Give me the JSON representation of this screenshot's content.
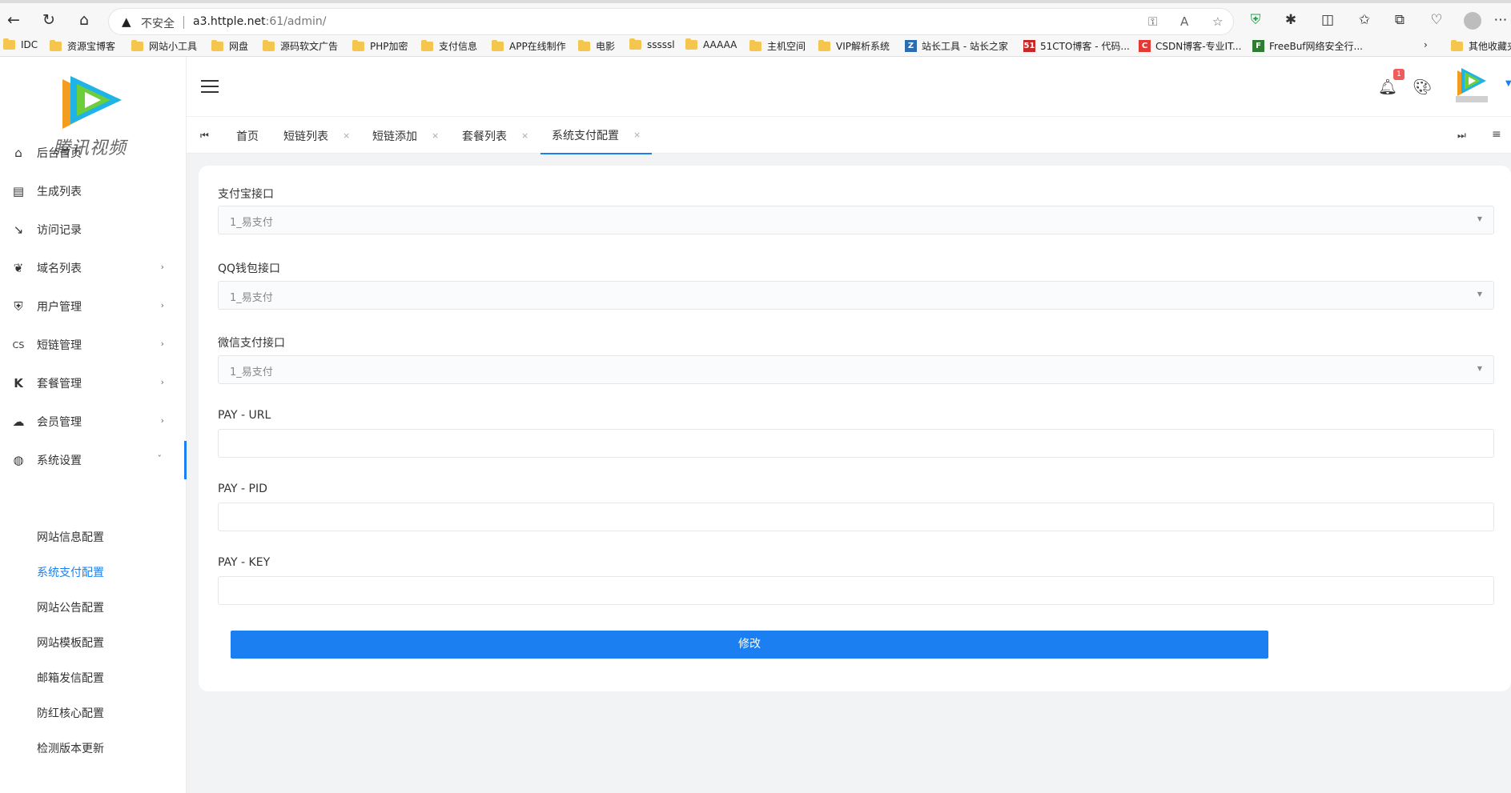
{
  "browser": {
    "insecure_label": "不安全",
    "url_host": "a3.httple.net",
    "url_rest": ":61/admin/",
    "bookmarks": [
      "IDC",
      "资源宝博客",
      "网站小工具",
      "网盘",
      "源码软文广告",
      "PHP加密",
      "支付信息",
      "APP在线制作",
      "电影",
      "sssssl",
      "AAAAA",
      "主机空间",
      "VIP解析系统",
      "站长工具 - 站长之家",
      "51CTO博客 - 代码...",
      "CSDN博客-专业IT...",
      "FreeBuf网络安全行...",
      "其他收藏夹"
    ]
  },
  "brand": {
    "logo_text": "腾讯视频"
  },
  "sidebar": {
    "items": [
      {
        "label": "后台首页",
        "icon": "home-icon"
      },
      {
        "label": "生成列表",
        "icon": "list-icon"
      },
      {
        "label": "访问记录",
        "icon": "record-icon"
      },
      {
        "label": "域名列表",
        "icon": "leaf-icon"
      },
      {
        "label": "用户管理",
        "icon": "user-shield-icon"
      },
      {
        "label": "短链管理",
        "icon": "link-icon"
      },
      {
        "label": "套餐管理",
        "icon": "package-icon"
      },
      {
        "label": "会员管理",
        "icon": "member-icon"
      },
      {
        "label": "系统设置",
        "icon": "globe-icon"
      }
    ],
    "submenu": [
      "网站信息配置",
      "系统支付配置",
      "网站公告配置",
      "网站模板配置",
      "邮箱发信配置",
      "防红核心配置",
      "检测版本更新"
    ]
  },
  "header": {
    "notification_count": "1"
  },
  "tabs": [
    {
      "label": "首页"
    },
    {
      "label": "短链列表"
    },
    {
      "label": "短链添加"
    },
    {
      "label": "套餐列表"
    },
    {
      "label": "系统支付配置"
    }
  ],
  "form": {
    "alipay_label": "支付宝接口",
    "alipay_value": "1_易支付",
    "qq_label": "QQ钱包接口",
    "qq_value": "1_易支付",
    "wechat_label": "微信支付接口",
    "wechat_value": "1_易支付",
    "pay_url_label": "PAY - URL",
    "pay_url_value": "",
    "pay_pid_label": "PAY - PID",
    "pay_pid_value": "",
    "pay_key_label": "PAY - KEY",
    "pay_key_value": "",
    "submit_label": "修改"
  },
  "colors": {
    "accent": "#1b7ff2",
    "badge": "#f15b5b"
  }
}
